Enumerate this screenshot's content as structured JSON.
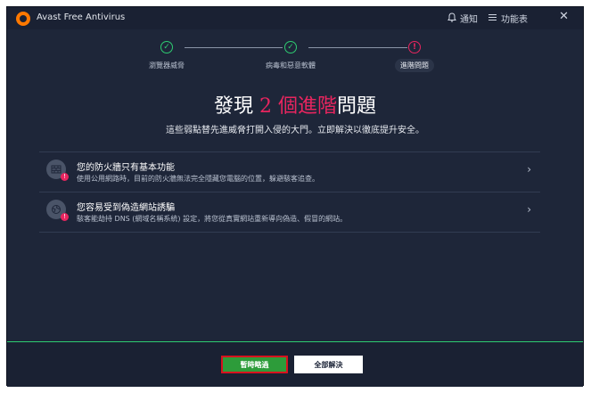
{
  "titlebar": {
    "app_title": "Avast Free Antivirus",
    "notifications_label": "通知",
    "menu_label": "功能表",
    "close_glyph": "✕"
  },
  "stepper": {
    "steps": [
      {
        "label": "瀏覽器威脅",
        "status": "done",
        "glyph": "✓"
      },
      {
        "label": "病毒和惡意軟體",
        "status": "done",
        "glyph": "✓"
      },
      {
        "label": "進階問題",
        "status": "active",
        "glyph": "!"
      }
    ]
  },
  "headline": {
    "prefix": "發現 ",
    "count": "2",
    "accent_text": " 個進階",
    "suffix": "問題"
  },
  "subtitle": "這些弱點替先進威脅打開入侵的大門。立即解決以徹底提升安全。",
  "issues": [
    {
      "icon": "firewall-icon",
      "title": "您的防火牆只有基本功能",
      "description": "使用公用網路時，目前的防火牆無法完全隱藏您電腦的位置，躲避駭客追查。"
    },
    {
      "icon": "dns-globe-icon",
      "title": "您容易受到偽造網站誘騙",
      "description": "駭客能劫持 DNS (網域名稱系統) 設定，將您從真實網站重新導向偽造、假冒的網站。"
    }
  ],
  "footer": {
    "skip_label": "暫時略過",
    "fix_all_label": "全部解決"
  },
  "colors": {
    "background": "#1e2639",
    "accent_pink": "#e8255f",
    "success_green": "#2ecc71",
    "brand_orange": "#ff7800"
  }
}
